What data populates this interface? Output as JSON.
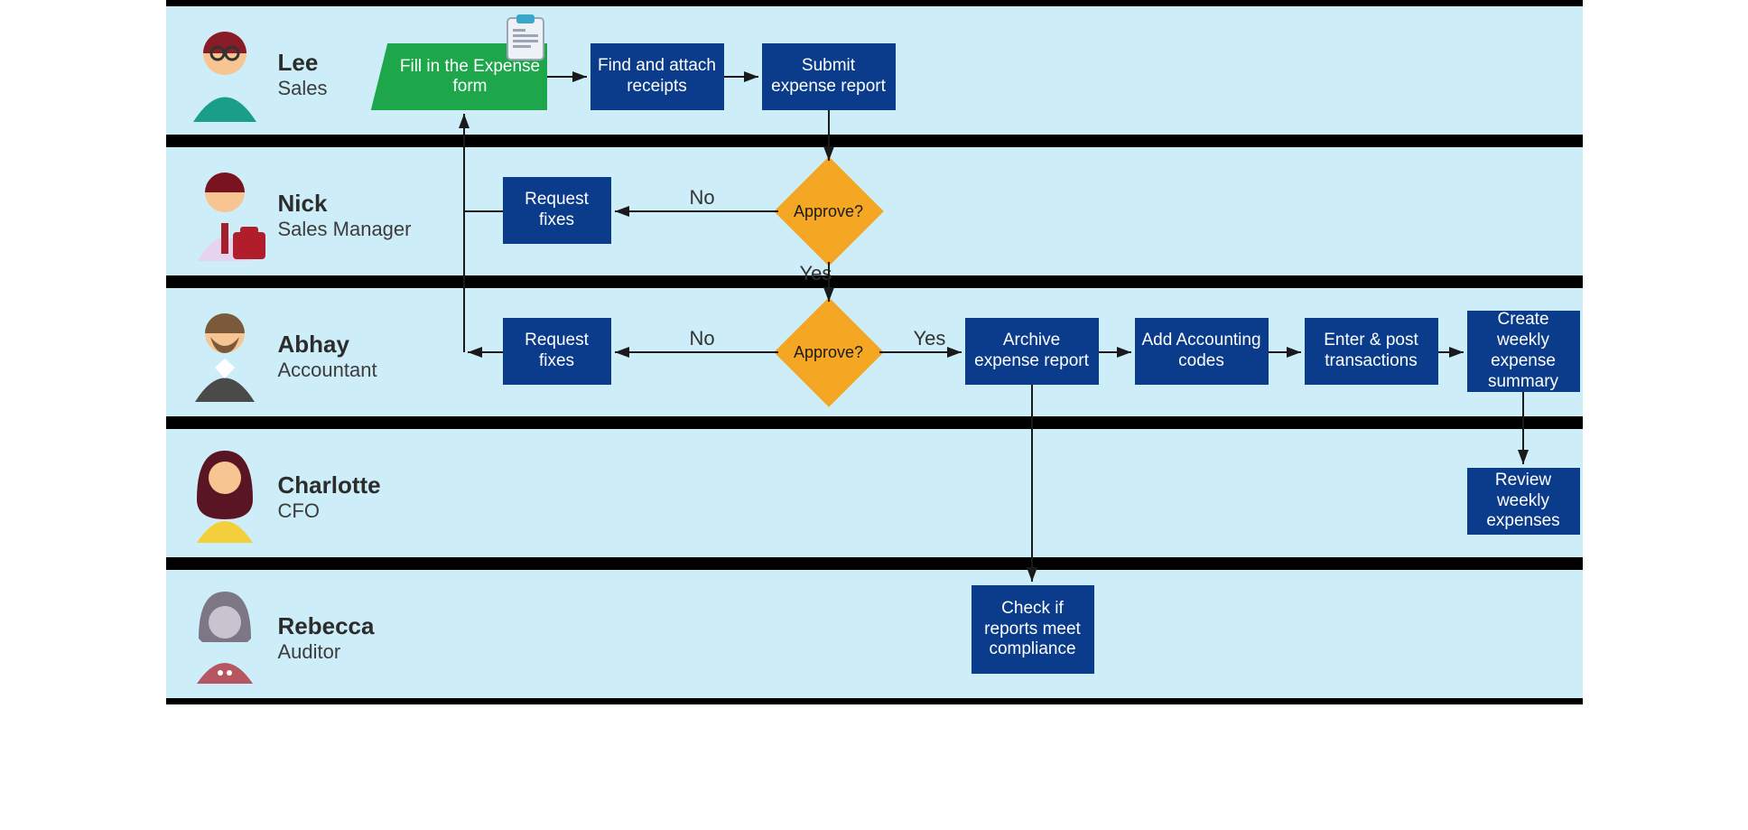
{
  "swimlanes": [
    {
      "name": "Lee",
      "role": "Sales"
    },
    {
      "name": "Nick",
      "role": "Sales Manager"
    },
    {
      "name": "Abhay",
      "role": "Accountant"
    },
    {
      "name": "Charlotte",
      "role": "CFO"
    },
    {
      "name": "Rebecca",
      "role": "Auditor"
    }
  ],
  "nodes": {
    "fill_form": "Fill in the Expense form",
    "find_receipts": "Find and attach receipts",
    "submit_report": "Submit expense report",
    "approve1": "Approve?",
    "request_fixes1": "Request fixes",
    "approve2": "Approve?",
    "request_fixes2": "Request fixes",
    "archive": "Archive expense report",
    "codes": "Add Accounting codes",
    "post_txn": "Enter & post transactions",
    "summary": "Create weekly expense summary",
    "cfo_review": "Review weekly expenses",
    "audit": "Check if reports meet compliance"
  },
  "edge_labels": {
    "no": "No",
    "yes": "Yes"
  },
  "icons": {
    "clipboard": "clipboard-icon"
  },
  "colors": {
    "lane_bg": "#cdeef9",
    "box": "#0b3c8c",
    "start": "#1ea64b",
    "diamond": "#f5a623"
  }
}
